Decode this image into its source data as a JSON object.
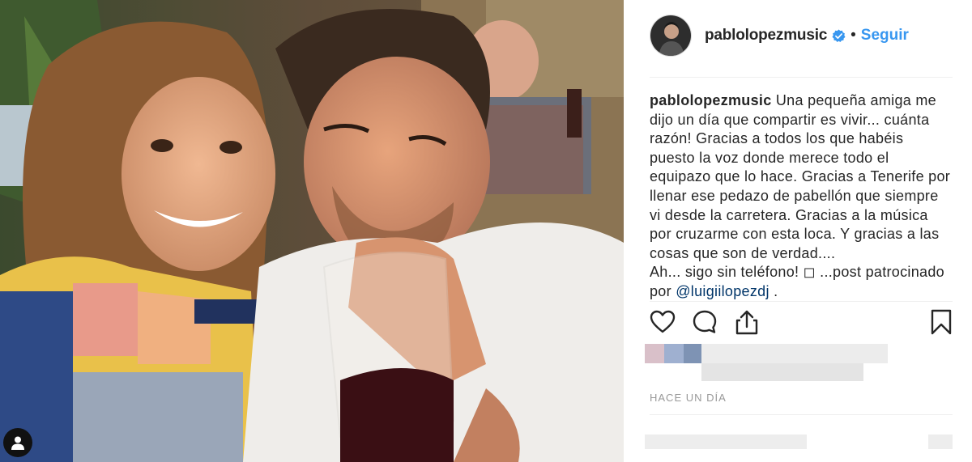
{
  "post": {
    "username": "pablolopezmusic",
    "separator": "•",
    "follow_label": "Seguir",
    "caption": {
      "lines": [
        "Una pequeña amiga me",
        "dijo un día que compartir es vivir... cuánta",
        "razón! Gracias a todos los que habéis",
        "puesto la voz donde merece todo el",
        "equipazo que lo hace. Gracias a Tenerife por",
        "llenar ese pedazo de pabellón que siempre",
        "vi desde la carretera. Gracias a la música",
        "por cruzarme con esta loca. Y gracias a las",
        "cosas que son de verdad....",
        "Ah... sigo sin teléfono! ◻ ...post patrocinado"
      ],
      "last_prefix": "por",
      "mention": "@luigiilopezdj",
      "last_suffix": "."
    },
    "timestamp": "HACE UN DÍA"
  },
  "icons": {
    "like": "heart-icon",
    "comment": "comment-icon",
    "share": "share-icon",
    "save": "bookmark-icon",
    "verified": "verified-badge-icon",
    "user": "user-icon"
  },
  "colors": {
    "link": "#3897f0",
    "mention": "#003569",
    "text": "#262626",
    "muted": "#999999"
  }
}
